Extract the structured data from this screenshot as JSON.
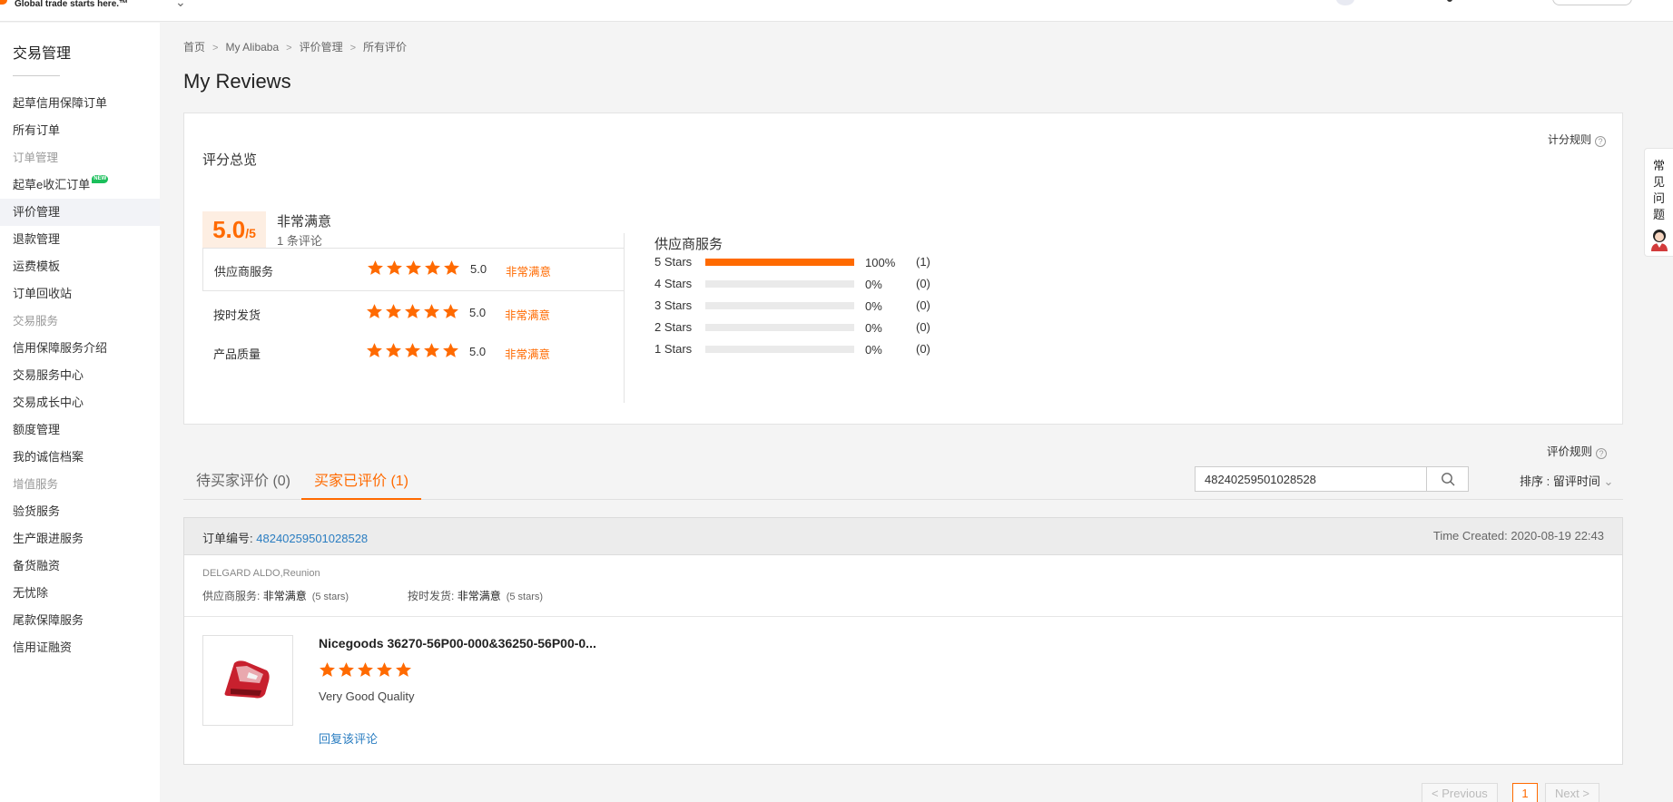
{
  "topbar": {
    "slogan": "Global trade starts here.™"
  },
  "sidebar": {
    "title": "交易管理",
    "items": [
      {
        "label": "起草信用保障订单",
        "type": "item"
      },
      {
        "label": "所有订单",
        "type": "item"
      },
      {
        "label": "订单管理",
        "type": "group"
      },
      {
        "label": "起草e收汇订单",
        "type": "item",
        "badge": "NEW"
      },
      {
        "label": "评价管理",
        "type": "item",
        "active": true
      },
      {
        "label": "退款管理",
        "type": "item"
      },
      {
        "label": "运费模板",
        "type": "item"
      },
      {
        "label": "订单回收站",
        "type": "item"
      },
      {
        "label": "交易服务",
        "type": "group"
      },
      {
        "label": "信用保障服务介绍",
        "type": "item"
      },
      {
        "label": "交易服务中心",
        "type": "item"
      },
      {
        "label": "交易成长中心",
        "type": "item"
      },
      {
        "label": "额度管理",
        "type": "item"
      },
      {
        "label": "我的诚信档案",
        "type": "item"
      },
      {
        "label": "增值服务",
        "type": "group"
      },
      {
        "label": "验货服务",
        "type": "item"
      },
      {
        "label": "生产跟进服务",
        "type": "item"
      },
      {
        "label": "备货融资",
        "type": "item"
      },
      {
        "label": "无忧除",
        "type": "item"
      },
      {
        "label": "尾款保障服务",
        "type": "item"
      },
      {
        "label": "信用证融资",
        "type": "item"
      }
    ]
  },
  "breadcrumb": [
    "首页",
    "My Alibaba",
    "评价管理",
    "所有评价"
  ],
  "page_title": "My Reviews",
  "overview": {
    "rules_link": "计分规则",
    "title": "评分总览",
    "score": "5.0",
    "score_max": "/5",
    "score_label": "非常满意",
    "review_count": "1 条评论",
    "ratings": [
      {
        "label": "供应商服务",
        "stars": 5,
        "value": "5.0",
        "word": "非常满意"
      },
      {
        "label": "按时发货",
        "stars": 5,
        "value": "5.0",
        "word": "非常满意"
      },
      {
        "label": "产品质量",
        "stars": 5,
        "value": "5.0",
        "word": "非常满意"
      }
    ],
    "distribution_title": "供应商服务",
    "distribution": [
      {
        "label": "5 Stars",
        "percent": 100,
        "percent_text": "100%",
        "count": "(1)"
      },
      {
        "label": "4 Stars",
        "percent": 0,
        "percent_text": "0%",
        "count": "(0)"
      },
      {
        "label": "3 Stars",
        "percent": 0,
        "percent_text": "0%",
        "count": "(0)"
      },
      {
        "label": "2 Stars",
        "percent": 0,
        "percent_text": "0%",
        "count": "(0)"
      },
      {
        "label": "1 Stars",
        "percent": 0,
        "percent_text": "0%",
        "count": "(0)"
      }
    ]
  },
  "reviews": {
    "rules_link": "评价规则",
    "tabs": [
      {
        "label": "待买家评价 (0)",
        "active": false
      },
      {
        "label": "买家已评价 (1)",
        "active": true
      }
    ],
    "search": {
      "value": "48240259501028528",
      "placeholder": ""
    },
    "sort_label": "排序 : 留评时间"
  },
  "order": {
    "number_label": "订单编号:",
    "number": "48240259501028528",
    "time_created": "Time Created: 2020-08-19 22:43",
    "buyer": "DELGARD ALDO,Reunion",
    "services": [
      {
        "label": "供应商服务:",
        "word": "非常满意",
        "stars": "(5 stars)"
      },
      {
        "label": "按时发货:",
        "word": "非常满意",
        "stars": "(5 stars)"
      }
    ],
    "product_name": "Nicegoods 36270-56P00-000&36250-56P00-0...",
    "product_stars": 5,
    "review_text": "Very Good Quality",
    "reply_link": "回复该评论"
  },
  "pagination": {
    "previous": "Previous",
    "current": "1",
    "next": "Next"
  },
  "faq": {
    "label": "常见问题"
  },
  "colors": {
    "accent": "#ff6a00",
    "link": "#2a7dc1",
    "bar_empty": "#eaeaea"
  }
}
